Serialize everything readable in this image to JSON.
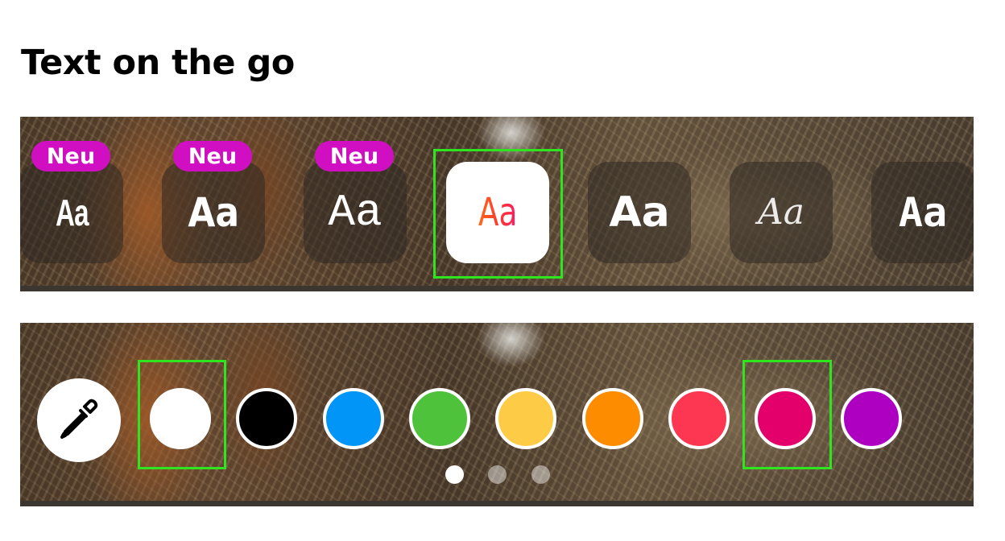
{
  "page": {
    "title": "Text on the go"
  },
  "font_picker": {
    "new_badge_label": "Neu",
    "fonts": [
      {
        "label": "Aa",
        "style": "condensed",
        "is_new": true,
        "selected": false
      },
      {
        "label": "Aa",
        "style": "rounded-bold",
        "is_new": true,
        "selected": false
      },
      {
        "label": "Aa",
        "style": "typewriter",
        "is_new": true,
        "selected": false
      },
      {
        "label": "Aa",
        "style": "gradient",
        "is_new": false,
        "selected": true
      },
      {
        "label": "Aa",
        "style": "bold",
        "is_new": false,
        "selected": false
      },
      {
        "label": "Aa",
        "style": "script",
        "is_new": false,
        "selected": false
      },
      {
        "label": "Aa",
        "style": "monospace-bold",
        "is_new": false,
        "selected": false
      }
    ]
  },
  "color_picker": {
    "eyedropper_icon": "eyedropper-icon",
    "swatches": [
      {
        "name": "white",
        "color": "#ffffff",
        "highlighted": true
      },
      {
        "name": "black",
        "color": "#000000",
        "highlighted": false
      },
      {
        "name": "blue",
        "color": "#0095f6",
        "highlighted": false
      },
      {
        "name": "green",
        "color": "#4fc23b",
        "highlighted": false
      },
      {
        "name": "yellow",
        "color": "#fdcb45",
        "highlighted": false
      },
      {
        "name": "orange",
        "color": "#fd8c00",
        "highlighted": false
      },
      {
        "name": "red",
        "color": "#fd3752",
        "highlighted": false
      },
      {
        "name": "magenta",
        "color": "#e4006a",
        "highlighted": true
      },
      {
        "name": "purple",
        "color": "#ad00c1",
        "highlighted": false
      }
    ],
    "page_count": 3,
    "active_page": 1
  },
  "colors": {
    "highlight_outline": "#2ee51f",
    "new_badge": "#d10fc2"
  }
}
